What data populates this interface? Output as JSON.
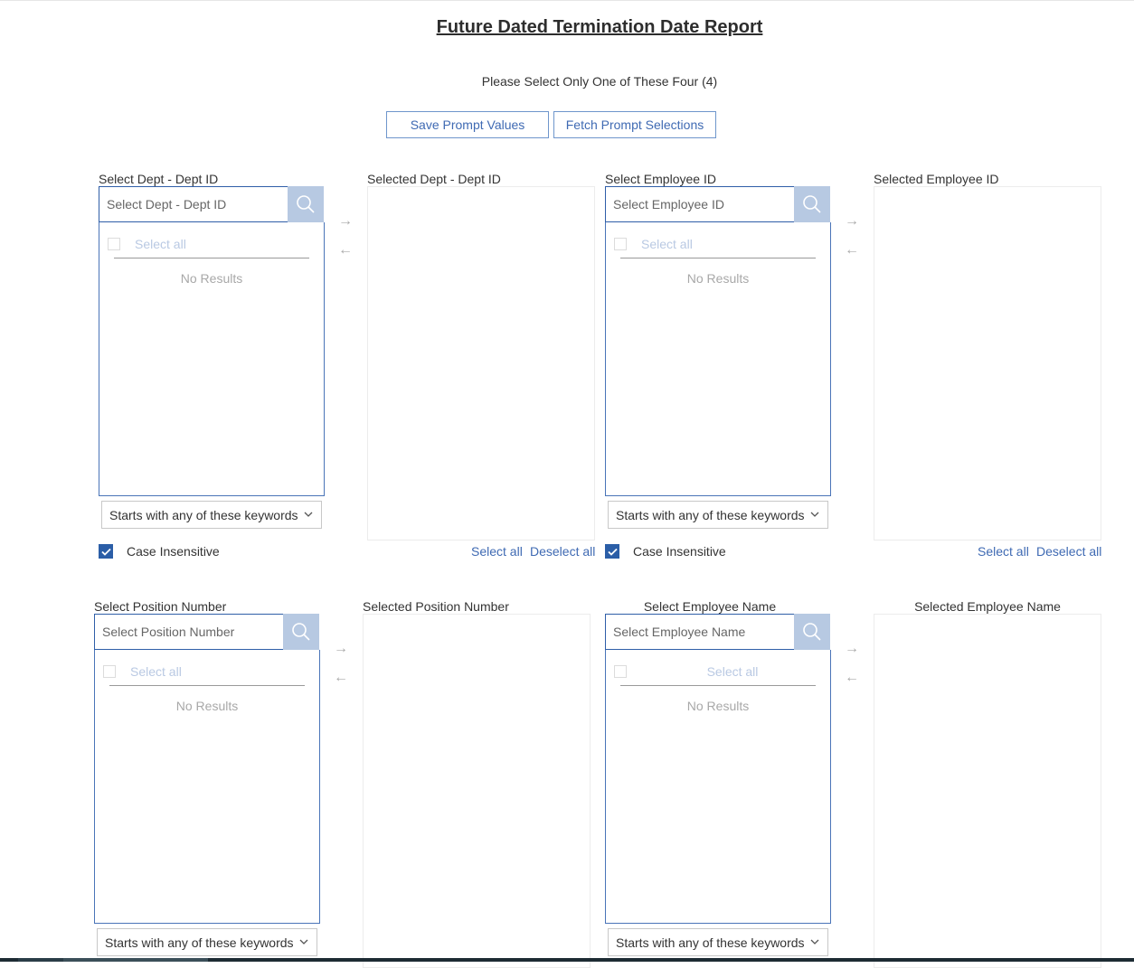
{
  "page": {
    "title": "Future Dated Termination Date Report",
    "subtitle": "Please Select Only One of These Four (4)"
  },
  "toolbar": {
    "save_label": "Save Prompt Values",
    "fetch_label": "Fetch Prompt Selections"
  },
  "icons": {
    "search": "search-icon",
    "move_right": "→",
    "move_left": "←",
    "chevron": "chevron-down-icon",
    "check": "checkmark-icon"
  },
  "colors": {
    "accent": "#2f5ea8",
    "link": "#3f6ab3",
    "search_button_bg": "#b7c9e2",
    "checkbox_checked": "#2b5ea7"
  },
  "prompts": {
    "dept": {
      "label": "Select Dept - Dept ID",
      "placeholder": "Select Dept - Dept ID",
      "select_all": "Select all",
      "no_results": "No Results",
      "match_mode": "Starts with any of these keywords",
      "case_insensitive_label": "Case Insensitive",
      "case_insensitive": true,
      "selected_label": "Selected Dept - Dept ID",
      "selected_items": [],
      "select_all_link": "Select all",
      "deselect_all_link": "Deselect all"
    },
    "employee_id": {
      "label": "Select Employee ID",
      "placeholder": "Select Employee ID",
      "select_all": "Select all",
      "no_results": "No Results",
      "match_mode": "Starts with any of these keywords",
      "case_insensitive_label": "Case Insensitive",
      "case_insensitive": true,
      "selected_label": "Selected Employee ID",
      "selected_items": [],
      "select_all_link": "Select all",
      "deselect_all_link": "Deselect all"
    },
    "position": {
      "label": "Select Position Number",
      "placeholder": "Select Position Number",
      "select_all": "Select all",
      "no_results": "No Results",
      "match_mode": "Starts with any of these keywords",
      "selected_label": "Selected Position Number",
      "selected_items": []
    },
    "employee_name": {
      "label": "Select Employee Name",
      "placeholder": "Select Employee Name",
      "select_all": "Select all",
      "no_results": "No Results",
      "match_mode": "Starts with any of these keywords",
      "selected_label": "Selected Employee Name",
      "selected_items": []
    }
  }
}
